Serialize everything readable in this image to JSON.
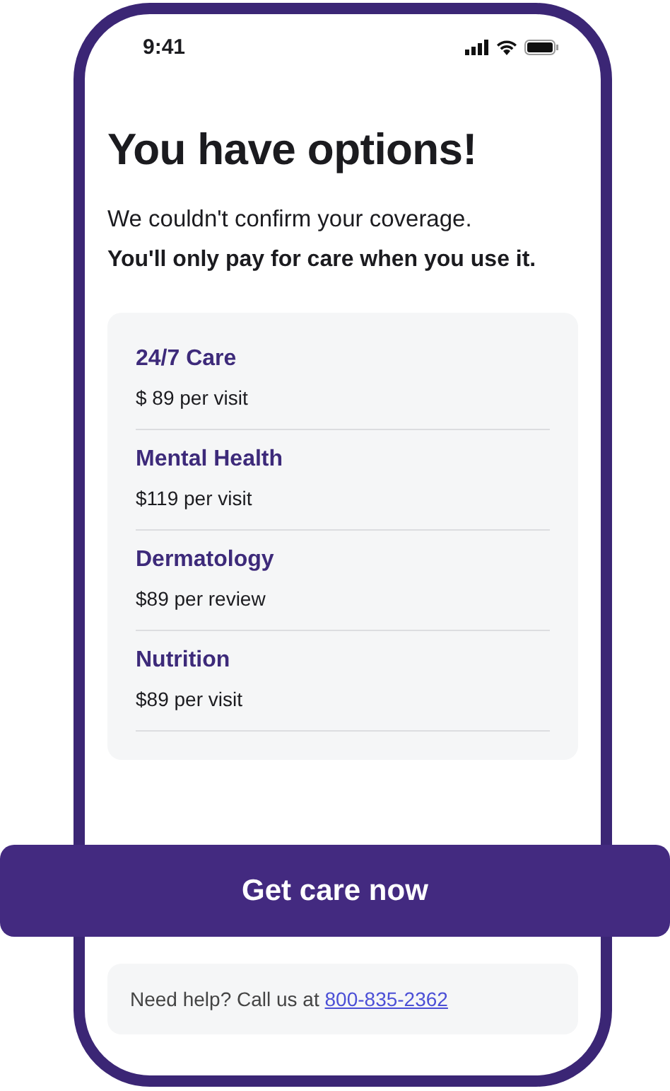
{
  "status_bar": {
    "time": "9:41"
  },
  "heading": "You have options!",
  "message": "We couldn't confirm your coverage.",
  "emphasis": "You'll only pay for care when you use it.",
  "services": [
    {
      "name": "24/7 Care",
      "price": "$ 89 per visit"
    },
    {
      "name": "Mental Health",
      "price": "$119 per visit"
    },
    {
      "name": "Dermatology",
      "price": "$89 per review"
    },
    {
      "name": "Nutrition",
      "price": "$89 per visit"
    }
  ],
  "primary_button": "Get care now",
  "help": {
    "text": "Need help? Call us at",
    "phone": "800-835-2362"
  }
}
